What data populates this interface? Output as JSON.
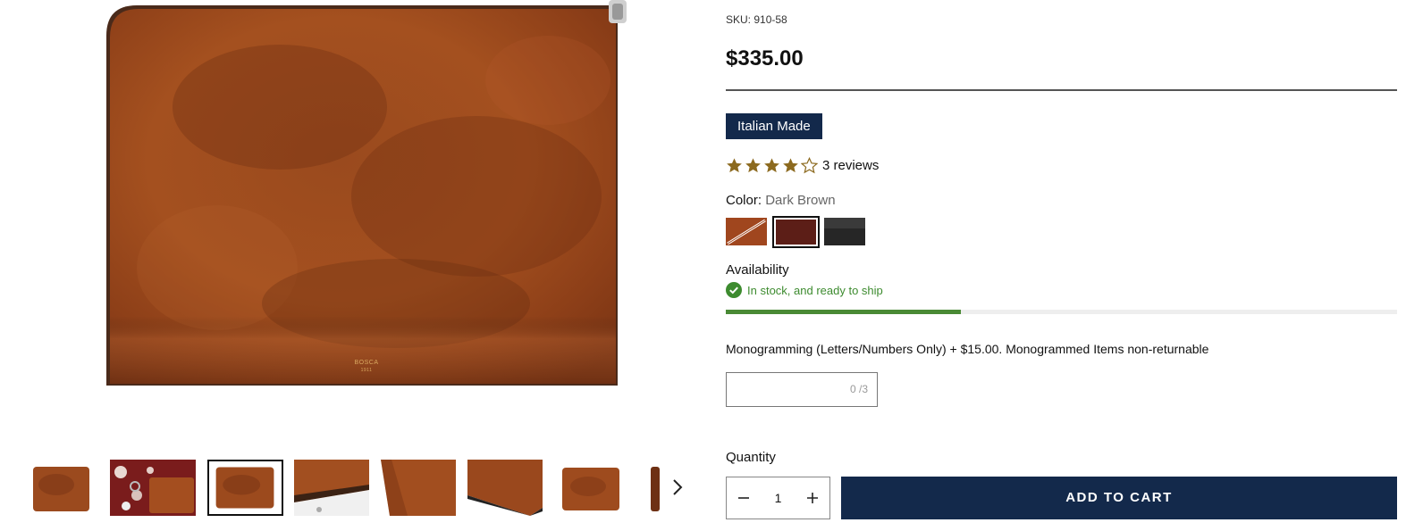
{
  "gallery": {
    "brand_stamp": "BOSCA",
    "brand_stamp_year": "1911",
    "thumbnails": [
      "thumbnail-front",
      "thumbnail-lifestyle",
      "thumbnail-front-selected",
      "thumbnail-zipper-detail",
      "thumbnail-logo-angle",
      "thumbnail-open-angle",
      "thumbnail-front-small",
      "thumbnail-side"
    ],
    "selected_thumbnail": 2,
    "next_icon": "chevron-right-icon"
  },
  "product": {
    "sku": "SKU: 910-58",
    "price": "$335.00",
    "badge": "Italian Made",
    "rating": 4,
    "rating_max": 5,
    "reviews": "3 reviews",
    "color_label": "Color:",
    "color_value": "Dark Brown",
    "swatches": [
      {
        "name": "Cognac",
        "color": "#a0461e"
      },
      {
        "name": "Dark Brown",
        "color": "#5c1e17"
      },
      {
        "name": "Black",
        "color": "#2a2a2a"
      }
    ],
    "selected_swatch": 1,
    "availability_label": "Availability",
    "stock_text": "In stock, and ready to ship",
    "stock_level": 0.35,
    "monogram_label": "Monogramming (Letters/Numbers Only) + $15.00. Monogrammed Items non-returnable",
    "monogram_value": "",
    "monogram_counter": "0 /3",
    "quantity_label": "Quantity",
    "quantity": "1",
    "add_to_cart": "ADD TO CART"
  },
  "colors": {
    "navy": "#13294b",
    "stock_green": "#3d8b2f",
    "star_gold": "#8c6a1f"
  }
}
